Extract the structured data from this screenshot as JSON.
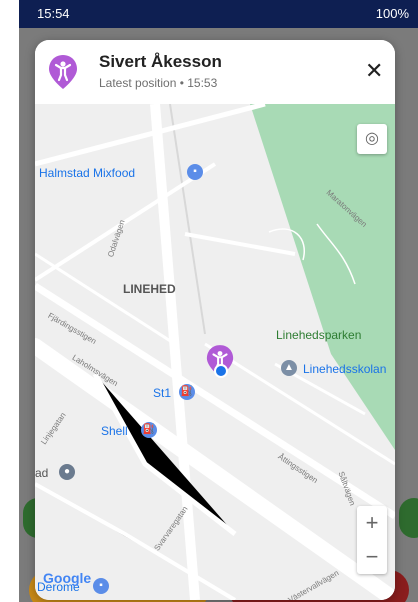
{
  "status_bar": {
    "time": "15:54",
    "battery": "100%"
  },
  "person": {
    "name": "Sivert Åkesson",
    "subtitle": "Latest position • 15:53",
    "pin_color": "#b05ad6"
  },
  "map": {
    "places": {
      "halmstad": "Halmstad Mixfood",
      "linehed": "LINEHED",
      "park": "Linehedsparken",
      "school": "Linehedsskolan",
      "st1": "St1",
      "shell": "Shell",
      "ad": "ad",
      "derome": "Derome"
    },
    "streets": {
      "odalvagen": "Odalvägen",
      "fjardingsstigen": "Fjärdingsstigen",
      "laholmsvagen": "Laholmsvägen",
      "linjegatan": "Linjegatan",
      "svarvaregatan": "Svarvaregatan",
      "attingsstigen": "Åttingsstigen",
      "saltvagen": "Såltvägen",
      "vastervallvagen": "Västervallvägen",
      "maratonvagen": "Maratonvägen"
    },
    "zoom_in": "+",
    "zoom_out": "−",
    "attribution": "Google"
  },
  "colors": {
    "status_bar": "#0e1f52",
    "park": "#a8dab5",
    "poi_blue": "#5b8de8"
  }
}
